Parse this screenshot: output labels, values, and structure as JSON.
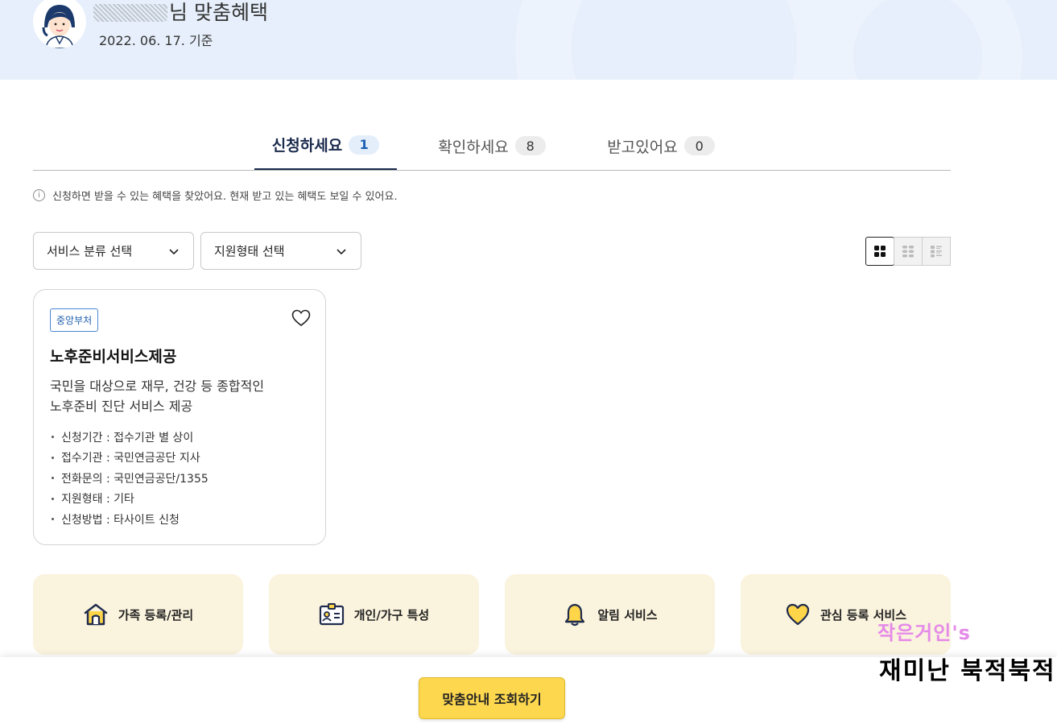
{
  "header": {
    "title_suffix": "님 맞춤혜택",
    "date": "2022. 06. 17. 기준"
  },
  "tabs": [
    {
      "label": "신청하세요",
      "count": "1"
    },
    {
      "label": "확인하세요",
      "count": "8"
    },
    {
      "label": "받고있어요",
      "count": "0"
    }
  ],
  "notice": "신청하면 받을 수 있는 혜택을 찾았어요. 현재 받고 있는 혜택도 보일 수 있어요.",
  "filters": {
    "service_category": "서비스 분류 선택",
    "support_type": "지원형태 선택"
  },
  "card": {
    "tag": "중앙부처",
    "title": "노후준비서비스제공",
    "desc_line1": "국민을 대상으로 재무, 건강 등 종합적인",
    "desc_line2": "노후준비 진단 서비스 제공",
    "details": [
      "신청기간 : 접수기관 별 상이",
      "접수기관 : 국민연금공단 지사",
      "전화문의 : 국민연금공단/1355",
      "지원형태 : 기타",
      "신청방법 : 타사이트 신청"
    ]
  },
  "quick_links": [
    {
      "label": "가족 등록/관리",
      "icon": "house-icon"
    },
    {
      "label": "개인/가구 특성",
      "icon": "id-card-icon"
    },
    {
      "label": "알림 서비스",
      "icon": "bell-icon"
    },
    {
      "label": "관심 등록 서비스",
      "icon": "heart-icon"
    }
  ],
  "cta": "맞춤안내 조회하기",
  "watermark": {
    "line1": "작은거인's",
    "line2": "재미난 북적북적"
  },
  "colors": {
    "header_bg": "#e6effb",
    "active_tab": "#1a2a4d",
    "tag_blue": "#1f5fae",
    "quick_bg": "#faf3dd",
    "cta_yellow": "#fdd84f",
    "icon_yellow": "#ffd54a",
    "icon_navy": "#1f2b4d"
  }
}
